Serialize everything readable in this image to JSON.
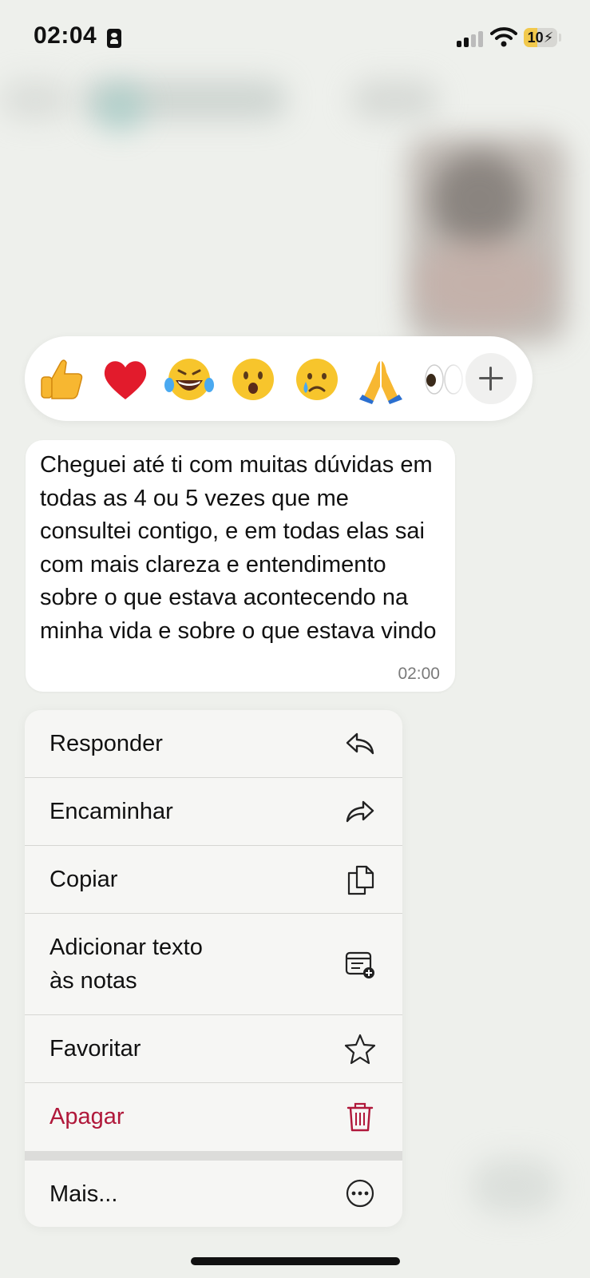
{
  "status_bar": {
    "time": "02:04",
    "battery": "10"
  },
  "reactions": {
    "emojis": [
      "thumbs-up",
      "red-heart",
      "tears-of-joy",
      "astonished-face",
      "crying-face",
      "folded-hands",
      "eyes"
    ],
    "more_label": "+"
  },
  "message": {
    "text": "Cheguei até ti com muitas dúvidas em todas as 4 ou 5 vezes que me consultei contigo, e em todas elas sai com mais clareza e entendimento sobre o que estava acontecendo na minha vida e sobre o que estava vindo",
    "time": "02:00"
  },
  "menu": {
    "items": [
      {
        "label": "Responder",
        "icon": "reply-icon"
      },
      {
        "label": "Encaminhar",
        "icon": "forward-icon"
      },
      {
        "label": "Copiar",
        "icon": "copy-icon"
      },
      {
        "label": "Adicionar texto\nàs notas",
        "icon": "add-note-icon"
      },
      {
        "label": "Favoritar",
        "icon": "star-icon"
      },
      {
        "label": "Apagar",
        "icon": "trash-icon"
      },
      {
        "label": "Mais...",
        "icon": "more-icon"
      }
    ]
  },
  "colors": {
    "background": "#eef0ec",
    "destructive": "#b0183a",
    "text": "#111111",
    "battery_low": "#f2c94c"
  }
}
